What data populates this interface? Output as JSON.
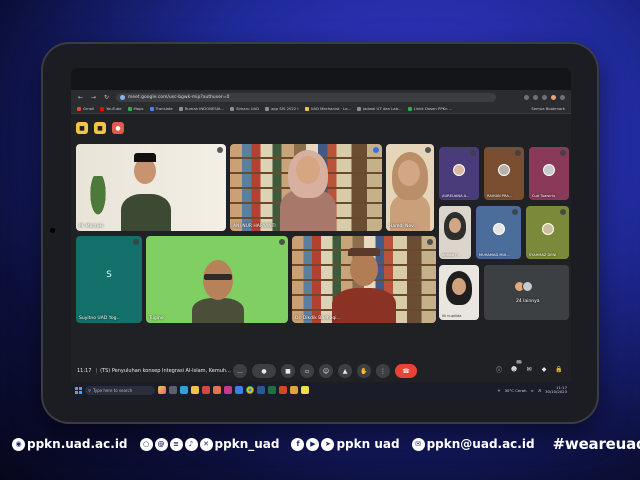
{
  "browser": {
    "url": "meet.google.com/usc-bgwk-mip?authuser=0",
    "bookmarks": [
      "Gmail",
      "YouTube",
      "Maps",
      "Translate",
      "Rumah INDONESIA...",
      "Simaru UAD",
      "app SIS 2022 I",
      "UAD Mechanist · Lo...",
      "Jadwal UT dan Lab...",
      "Linkk Dosen PPKn ..."
    ],
    "all_bookmarks": "Semua Bookmark"
  },
  "meet": {
    "time": "11:17",
    "meeting_title": "(TS) Penyuluhan konsep Integrasi Al-Islam, Kemuh...",
    "participants_badge": "35",
    "tiles": [
      {
        "name": "M. Marzuki"
      },
      {
        "name": "ANI NUR HARYANTI"
      },
      {
        "name": "Hamdi Nov..."
      },
      {
        "name": "AURELIANA A..."
      },
      {
        "name": "RAIHAN PRA..."
      },
      {
        "name": "Cud Tuaisiriu"
      },
      {
        "name": "Annisa F..."
      },
      {
        "name": "MUHAMAD MUI..."
      },
      {
        "name": "SYAHMAZ DENI"
      },
      {
        "name": "Suyitno UAD Yog...",
        "initial": "S"
      },
      {
        "name": "Tugino"
      },
      {
        "name": "Dr. Dikdik Baehaqi..."
      },
      {
        "name": "lili nupilida"
      },
      {
        "name": "24 lainnya"
      }
    ]
  },
  "taskbar": {
    "search": "Type here to search",
    "weather": "30°C Cerah",
    "time": "11:17",
    "date": "30/10/2023"
  },
  "footer": {
    "website": "ppkn.uad.ac.id",
    "social": "ppkn_uad",
    "social2": "ppkn uad",
    "email": "ppkn@uad.ac.id",
    "hashtag": "#weareuad"
  },
  "colors": {
    "tile_s_bg": "#13706a",
    "tile_tugino_bg": "#7fcf63",
    "end_call": "#ea4335"
  }
}
